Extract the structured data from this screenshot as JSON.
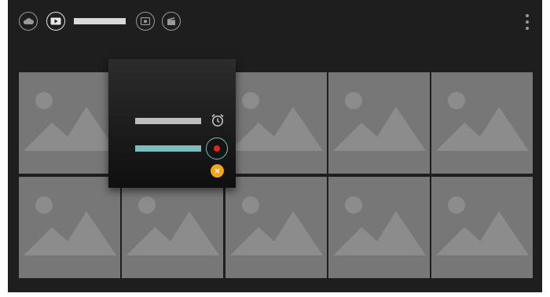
{
  "top_bar": {
    "icons": [
      "cloud-icon",
      "play-video-icon",
      "photo-icon",
      "clapperboard-icon"
    ],
    "more_icon": "more-vertical-icon"
  },
  "grid": {
    "tile_icon": "image-placeholder-icon",
    "tile_count": 10
  },
  "popup": {
    "items": [
      {
        "icon": "alarm-clock-icon"
      },
      {
        "icon": "record-icon",
        "selected": true
      }
    ],
    "close_icon": "close-icon"
  },
  "colors": {
    "background": "#1e1e1e",
    "tile": "#777777",
    "accent_teal": "#7bbdbd",
    "record_red": "#e0261c",
    "close_orange": "#f3a51f"
  }
}
